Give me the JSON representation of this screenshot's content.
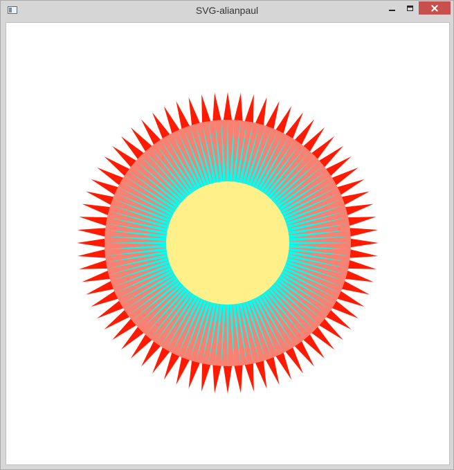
{
  "window": {
    "title": "SVG-alianpaul",
    "app_icon": "window-app-icon",
    "controls": [
      "minimize-icon",
      "maximize-icon",
      "close-icon"
    ]
  },
  "figure": {
    "outer_spike_count": 72,
    "inner_ray_count": 120,
    "colors": {
      "outer_spikes": "#ff1a00",
      "salmon_ring": "#fa8072",
      "cyan_rays": "#00ffee",
      "center_disc": "#fff08a"
    }
  }
}
